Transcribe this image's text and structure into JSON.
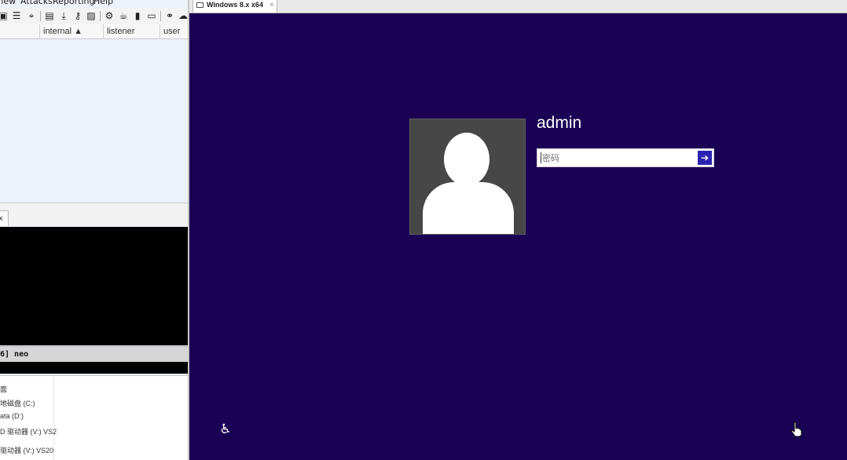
{
  "host_app": {
    "menu": [
      "View",
      "Attacks",
      "Reporting",
      "Help"
    ],
    "toolbar_icons": [
      "screenshot-icon",
      "list-icon",
      "crosshair-icon",
      "image-card-icon",
      "download-icon",
      "key-icon",
      "picture-icon",
      "gear-icon",
      "coffee-icon",
      "document-icon",
      "terminal-icon",
      "link-icon",
      "cloud-icon"
    ],
    "columns": [
      {
        "label": "internal ▲"
      },
      {
        "label": "listener"
      },
      {
        "label": "user"
      }
    ],
    "tab_close": "x",
    "status_text": "6] neo",
    "explorer_items": [
      "面",
      "地磁盘 (C:)",
      "ata (D:)",
      "D 驱动器 (V:) VS2",
      "驱动器 (V:) VS20"
    ]
  },
  "vm_window": {
    "tab_title": "Windows 8.x x64",
    "tab_close": "×"
  },
  "lock_screen": {
    "background_color": "#1b0154",
    "username": "admin",
    "password_placeholder": "密码",
    "password_value": "",
    "submit_icon": "arrow-right-icon",
    "ease_of_access_icon": "ease-of-access-icon",
    "cursor_icon": "hand-cursor-icon"
  }
}
